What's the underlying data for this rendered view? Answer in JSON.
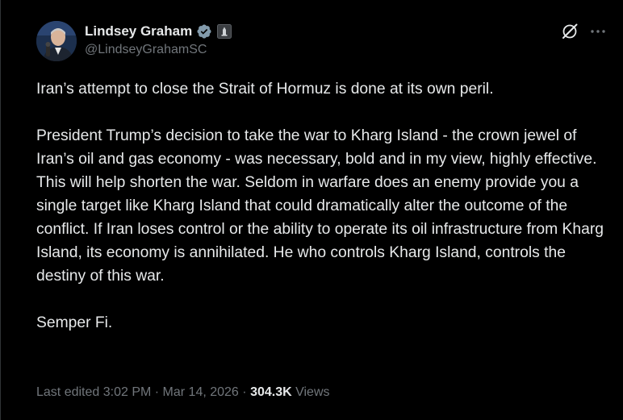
{
  "author": {
    "display_name": "Lindsey Graham",
    "handle": "@LindseyGrahamSC",
    "verified": true,
    "affiliation_badge": "senate-seal-icon"
  },
  "actions": {
    "grok_icon": "grok-slash-icon",
    "more_icon": "more-horizontal-icon"
  },
  "tweet": {
    "paragraphs": [
      "Iran’s attempt to close the Strait of Hormuz is done at its own peril.",
      "President Trump’s decision to take the war to Kharg Island - the crown jewel of Iran’s oil and gas economy - was necessary, bold and in my view, highly effective. This will help shorten the war. Seldom in warfare does an enemy provide you a single target like Kharg Island that could dramatically alter the outcome of the conflict. If Iran loses control or the ability to operate its oil infrastructure from Kharg Island, its economy is annihilated. He who controls Kharg Island, controls the destiny of this war.",
      "Semper Fi."
    ]
  },
  "meta": {
    "last_edited": "Last edited 3:02 PM",
    "separator": "·",
    "date": "Mar 14, 2026",
    "views_count": "304.3K",
    "views_label": "Views"
  },
  "colors": {
    "background": "#000000",
    "text_primary": "#e7e9ea",
    "text_secondary": "#71767b",
    "verified_badge": "#829aab"
  }
}
